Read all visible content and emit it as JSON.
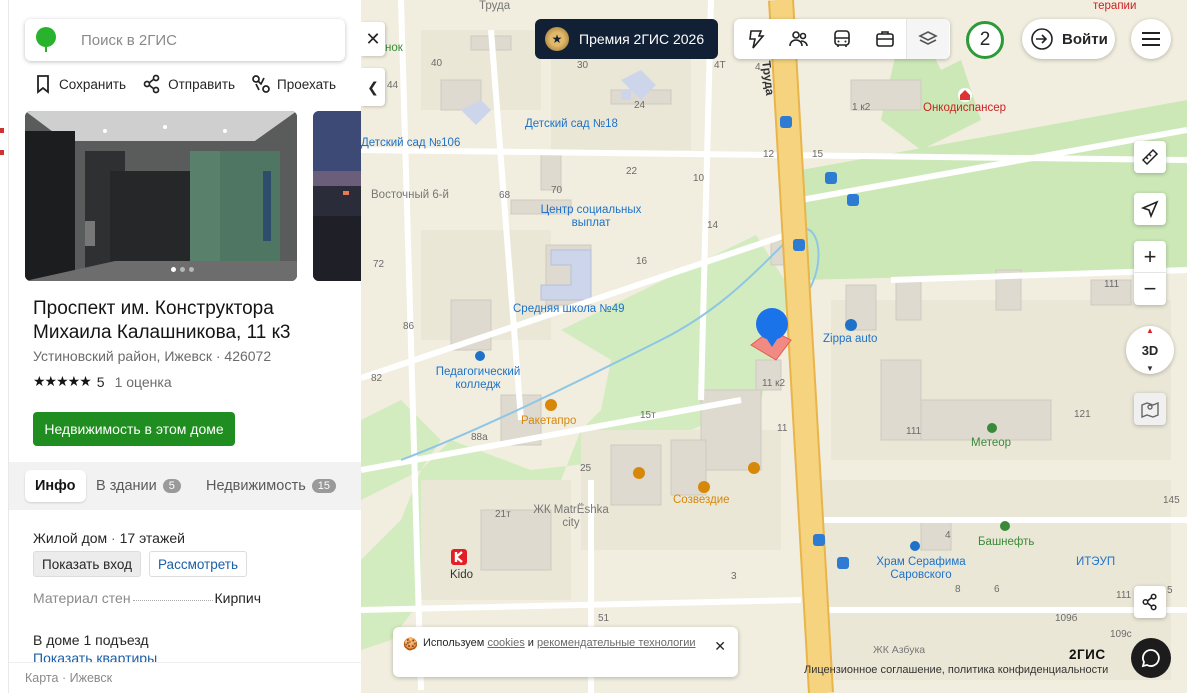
{
  "search": {
    "placeholder": "Поиск в 2ГИС"
  },
  "actions": {
    "save": "Сохранить",
    "share": "Отправить",
    "route": "Проехать"
  },
  "place": {
    "title": "Проспект им. Конструктора Михаила Калашникова, 11 к3",
    "district": "Устиновский район, Ижевск",
    "postcode": "426072",
    "rating_value": "5",
    "rating_count": "1 оценка",
    "stars": "★★★★★"
  },
  "realty_button": "Недвижимость в этом доме",
  "tabs": [
    {
      "label": "Инфо"
    },
    {
      "label": "В здании",
      "count": "5"
    },
    {
      "label": "Недвижимость",
      "count": "15"
    }
  ],
  "info": {
    "type": "Жилой дом",
    "floors": "17 этажей",
    "show_entrance": "Показать вход",
    "inspect": "Рассмотреть",
    "material_key": "Материал стен",
    "material_value": "Кирпич",
    "entrances": "В доме 1 подъезд",
    "show_apartments": "Показать квартиры"
  },
  "footer": {
    "map": "Карта",
    "city": "Ижевск",
    "sep": "·"
  },
  "topbar": {
    "premium": "Премия 2ГИС 2026",
    "counter": "2",
    "login": "Войти"
  },
  "map_labels": {
    "street_truda_top": "Труда",
    "street_truda": "Труда",
    "terapii": "терапии",
    "vostochny": "Восточный 6-й",
    "onko": "Онкодиспансер",
    "kg18": "Детский сад №18",
    "kg106": "Детский сад №106",
    "social": "Центр социальных выплат",
    "school49": "Средняя школа №49",
    "pedcollege": "Педагогический колледж",
    "raketapro": "Ракетапро",
    "sozvezdie": "Созвездие",
    "matreshka": "ЖК MatrЁshka city",
    "kido": "Kido",
    "zippa": "Zippa auto",
    "meteor": "Метеор",
    "hram": "Храм Серафима Саровского",
    "bashneft": "Башнефть",
    "itaup": "ИТЭУП",
    "azbuka": "ЖК Азбука",
    "chnok": "чнок"
  },
  "house_numbers": [
    "40",
    "30",
    "4Т",
    "4",
    "1 к2",
    "44",
    "24",
    "12",
    "15",
    "22",
    "10",
    "68",
    "70",
    "14",
    "16",
    "72",
    "86",
    "82",
    "11 к2",
    "15т",
    "11",
    "88а",
    "111",
    "25",
    "21т",
    "4",
    "6",
    "8",
    "3",
    "51",
    "109б",
    "109с",
    "111",
    "121",
    "145",
    "111",
    "5"
  ],
  "cookie": {
    "prefix": "Используем",
    "link1": "cookies",
    "and": "и",
    "link2": "рекомендательные технологии"
  },
  "license": "Лицензионное соглашение, политика конфиденциальности",
  "brand": "2ГИС",
  "map_controls": {
    "btn_3d": "3D"
  },
  "colors": {
    "green_button": "#1f8d1f",
    "premium_bg": "#122036",
    "pin": "#1a73e8",
    "counter_ring": "#2d9a3a"
  }
}
